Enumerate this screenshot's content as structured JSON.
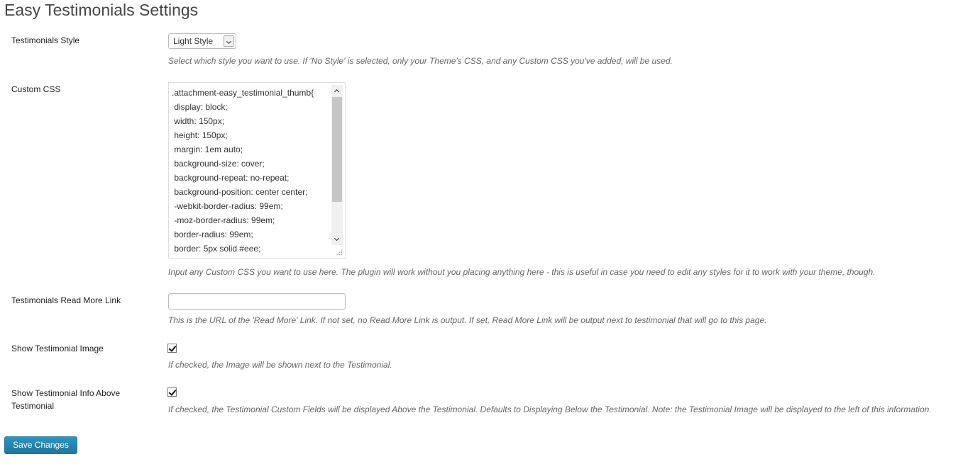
{
  "page": {
    "title": "Easy Testimonials Settings"
  },
  "style_setting": {
    "label": "Testimonials Style",
    "selected": "Light Style",
    "description": "Select which style you want to use. If 'No Style' is selected, only your Theme's CSS, and any Custom CSS you've added, will be used."
  },
  "custom_css": {
    "label": "Custom CSS",
    "lines": [
      ".attachment-easy_testimonial_thumb{",
      " display: block;",
      " width: 150px;",
      " height: 150px;",
      " margin: 1em auto;",
      " background-size: cover;",
      " background-repeat: no-repeat;",
      " background-position: center center;",
      " -webkit-border-radius: 99em;",
      " -moz-border-radius: 99em;",
      " border-radius: 99em;",
      " border: 5px solid #eee;"
    ],
    "description": "Input any Custom CSS you want to use here. The plugin will work without you placing anything here - this is useful in case you need to edit any styles for it to work with your theme, though."
  },
  "read_more": {
    "label": "Testimonials Read More Link",
    "value": "",
    "description": "This is the URL of the 'Read More' Link. If not set, no Read More Link is output. If set, Read More Link will be output next to testimonial that will go to this page."
  },
  "show_image": {
    "label": "Show Testimonial Image",
    "checked": true,
    "description": "If checked, the Image will be shown next to the Testimonial."
  },
  "show_info_above": {
    "label": "Show Testimonial Info Above Testimonial",
    "checked": true,
    "description": "If checked, the Testimonial Custom Fields will be displayed Above the Testimonial. Defaults to Displaying Below the Testimonial. Note: the Testimonial Image will be displayed to the left of this information."
  },
  "actions": {
    "save_label": "Save Changes"
  },
  "colors": {
    "button": "#21759b",
    "description_text": "#666666"
  }
}
